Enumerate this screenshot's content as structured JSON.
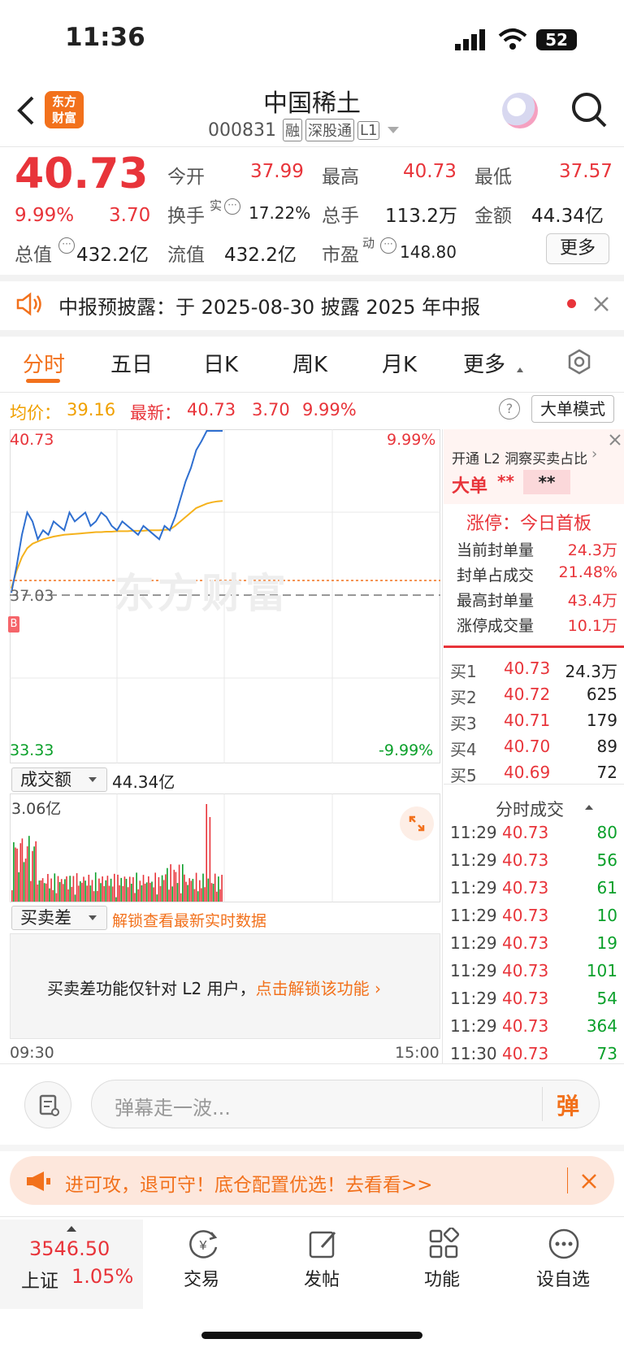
{
  "status": {
    "time": "11:36",
    "battery": "52"
  },
  "header": {
    "logo_line1": "东方",
    "logo_line2": "财富",
    "title": "中国稀土",
    "code": "000831",
    "tag_rong": "融",
    "tag_sgt": "深股通",
    "tag_l1": "L1"
  },
  "quote": {
    "price": "40.73",
    "pct": "9.99%",
    "chg": "3.70",
    "open_label": "今开",
    "open": "37.99",
    "high_label": "最高",
    "high": "40.73",
    "low_label": "最低",
    "low": "37.57",
    "turnover_label": "换手",
    "turnover_sup": "实",
    "turnover": "17.22%",
    "vol_label": "总手",
    "vol": "113.2万",
    "amt_label": "金额",
    "amt": "44.34亿",
    "mcap_label": "总值",
    "mcap": "432.2亿",
    "float_label": "流值",
    "float": "432.2亿",
    "pe_label": "市盈",
    "pe_sup": "动",
    "pe": "148.80",
    "more": "更多"
  },
  "notice": {
    "text": "中报预披露：于 2025-08-30 披露 2025 年中报"
  },
  "tabs": [
    "分时",
    "五日",
    "日K",
    "周K",
    "月K",
    "更多"
  ],
  "avgbar": {
    "avg_label": "均价：",
    "avg": "39.16",
    "last_label": "最新：",
    "last": "40.73",
    "chg": "3.70",
    "pct": "9.99%",
    "mode_btn": "大单模式"
  },
  "chart": {
    "y_top": "40.73",
    "y_mid": "37.03",
    "y_bot": "33.33",
    "pct_top": "9.99%",
    "pct_bot": "-9.99%",
    "watermark": "东方财富",
    "marker": "B",
    "vol_select": "成交额",
    "vol_total": "44.34亿",
    "vol_max": "3.06亿",
    "diff_select": "买卖差",
    "diff_link": "解锁查看最新实时数据",
    "diff_msg": "买卖差功能仅针对 L2 用户，",
    "diff_action": "点击解锁该功能",
    "t_start": "09:30",
    "t_end": "15:00"
  },
  "chart_data": {
    "type": "line",
    "x_range": [
      "09:30",
      "15:00"
    ],
    "ylim": [
      33.33,
      40.73
    ],
    "prev_close": 37.03,
    "price": [
      37.1,
      37.7,
      38.4,
      38.9,
      38.7,
      38.3,
      38.5,
      38.4,
      38.7,
      38.6,
      38.5,
      38.9,
      38.7,
      38.8,
      38.9,
      38.6,
      38.7,
      38.9,
      38.8,
      38.6,
      38.5,
      38.7,
      38.6,
      38.5,
      38.4,
      38.6,
      38.5,
      38.4,
      38.3,
      38.6,
      38.5,
      38.8,
      39.2,
      39.6,
      39.9,
      40.3,
      40.5,
      40.73,
      40.73,
      40.73,
      40.73
    ],
    "avg": [
      37.2,
      37.6,
      37.9,
      38.1,
      38.2,
      38.25,
      38.3,
      38.33,
      38.36,
      38.38,
      38.4,
      38.41,
      38.42,
      38.43,
      38.44,
      38.45,
      38.46,
      38.46,
      38.47,
      38.47,
      38.48,
      38.48,
      38.48,
      38.49,
      38.49,
      38.49,
      38.5,
      38.5,
      38.5,
      38.51,
      38.52,
      38.6,
      38.7,
      38.8,
      38.9,
      39.0,
      39.05,
      39.1,
      39.13,
      39.15,
      39.16
    ]
  },
  "level1": {
    "title": "开通 L2 洞察买卖占比",
    "big_label": "大单",
    "big_val1": "**",
    "big_val2": "**",
    "limit_title": "涨停：今日首板",
    "rows": [
      {
        "label": "当前封单量",
        "val": "24.3万"
      },
      {
        "label": "封单占成交",
        "val": "21.48%"
      },
      {
        "label": "最高封单量",
        "val": "43.4万"
      },
      {
        "label": "涨停成交量",
        "val": "10.1万"
      }
    ],
    "bids": [
      {
        "label": "买1",
        "price": "40.73",
        "vol": "24.3万"
      },
      {
        "label": "买2",
        "price": "40.72",
        "vol": "625"
      },
      {
        "label": "买3",
        "price": "40.71",
        "vol": "179"
      },
      {
        "label": "买4",
        "price": "40.70",
        "vol": "89"
      },
      {
        "label": "买5",
        "price": "40.69",
        "vol": "72"
      }
    ],
    "ticks_title": "分时成交",
    "ticks": [
      {
        "t": "11:29",
        "p": "40.73",
        "v": "80"
      },
      {
        "t": "11:29",
        "p": "40.73",
        "v": "56"
      },
      {
        "t": "11:29",
        "p": "40.73",
        "v": "61"
      },
      {
        "t": "11:29",
        "p": "40.73",
        "v": "10"
      },
      {
        "t": "11:29",
        "p": "40.73",
        "v": "19"
      },
      {
        "t": "11:29",
        "p": "40.73",
        "v": "101"
      },
      {
        "t": "11:29",
        "p": "40.73",
        "v": "54"
      },
      {
        "t": "11:29",
        "p": "40.73",
        "v": "364"
      },
      {
        "t": "11:30",
        "p": "40.73",
        "v": "73"
      }
    ]
  },
  "comment": {
    "placeholder": "弹幕走一波...",
    "dan": "弹"
  },
  "promo": {
    "text": "进可攻，退可守！底仓配置优选！去看看>>"
  },
  "bottomnav": {
    "index_value": "3546.50",
    "index_name": "上证",
    "index_pct": "1.05%",
    "items": [
      "交易",
      "发帖",
      "功能",
      "设自选"
    ]
  }
}
